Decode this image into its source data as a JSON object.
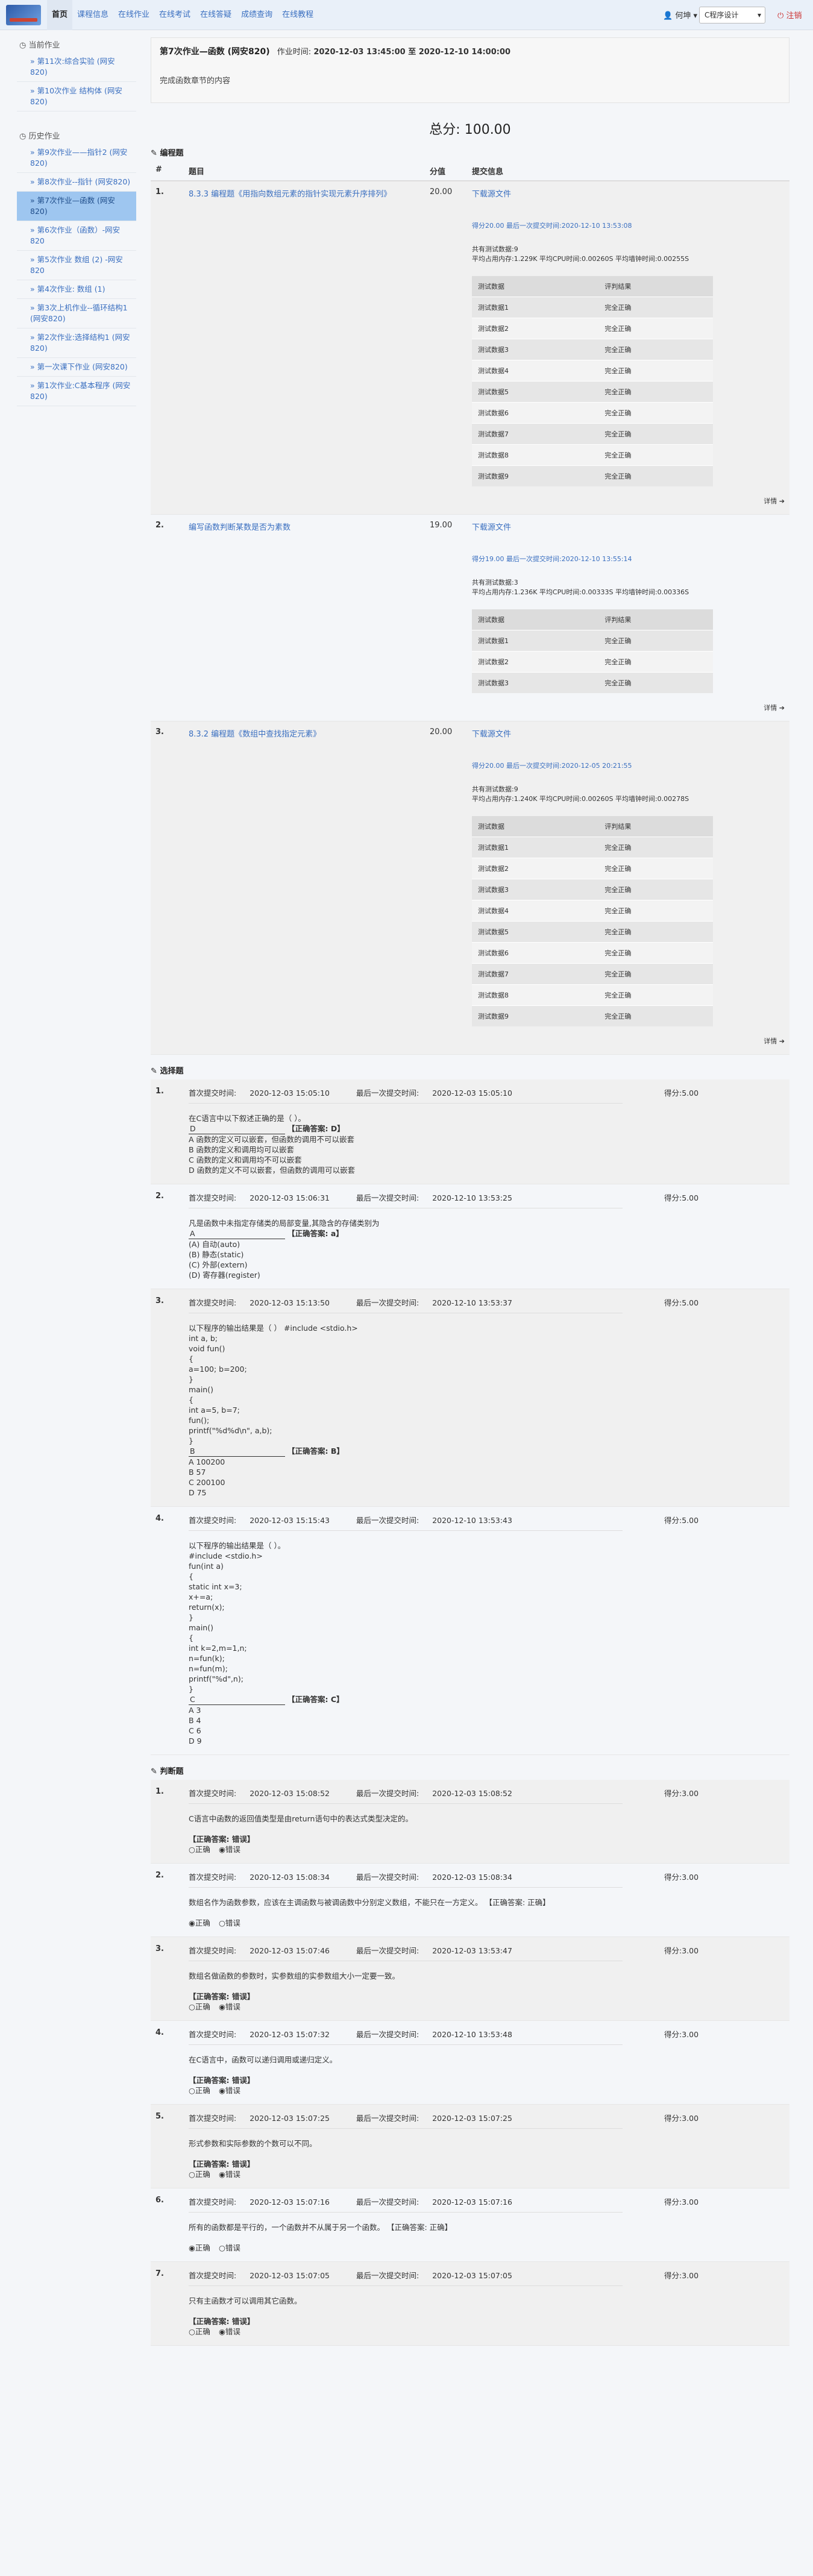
{
  "nav": {
    "items": [
      "首页",
      "课程信息",
      "在线作业",
      "在线考试",
      "在线答疑",
      "成绩查询",
      "在线教程"
    ],
    "active_index": 0,
    "user": "何坤",
    "course": "C程序设计",
    "logout": "注销"
  },
  "sidebar": {
    "current_label": "当前作业",
    "current_items": [
      "第11次:综合实验 (网安820)",
      "第10次作业 结构体 (网安820)"
    ],
    "history_label": "历史作业",
    "history_items": [
      "第9次作业——指针2 (网安820)",
      "第8次作业--指针 (网安820)",
      "第7次作业—函数 (网安820)",
      "第6次作业（函数）-网安820",
      "第5次作业 数组 (2) -网安820",
      "第4次作业: 数组 (1)",
      "第3次上机作业--循环结构1 (网安820)",
      "第2次作业:选择结构1 (网安820)",
      "第一次课下作业 (网安820)",
      "第1次作业:C基本程序 (网安820)"
    ],
    "active_history_index": 2
  },
  "homework": {
    "title": "第7次作业—函数 (网安820)",
    "time_label": "作业时间:",
    "time_value": "2020-12-03 13:45:00 至 2020-12-10 14:00:00",
    "desc": "完成函数章节的内容",
    "total": "总分: 100.00"
  },
  "programming": {
    "section": "编程题",
    "headers": [
      "#",
      "题目",
      "分值",
      "提交信息"
    ],
    "download": "下载源文件",
    "detail": "详情",
    "tc_headers": [
      "测试数据",
      "评判结果"
    ],
    "problems": [
      {
        "no": "1.",
        "name": "8.3.3 编程题《用指向数组元素的指针实现元素升序排列》",
        "score": "20.00",
        "meta": "得分20.00   最后一次提交时间:2020-12-10 13:53:08",
        "meta2": "共有测试数据:9\n平均占用内存:1.229K    平均CPU时间:0.00260S    平均墙钟时间:0.00255S",
        "tests": [
          "测试数据1",
          "测试数据2",
          "测试数据3",
          "测试数据4",
          "测试数据5",
          "测试数据6",
          "测试数据7",
          "测试数据8",
          "测试数据9"
        ],
        "result": "完全正确"
      },
      {
        "no": "2.",
        "name": "编写函数判断某数是否为素数",
        "score": "19.00",
        "meta": "得分19.00   最后一次提交时间:2020-12-10 13:55:14",
        "meta2": "共有测试数据:3\n平均占用内存:1.236K    平均CPU时间:0.00333S    平均墙钟时间:0.00336S",
        "tests": [
          "测试数据1",
          "测试数据2",
          "测试数据3"
        ],
        "result": "完全正确"
      },
      {
        "no": "3.",
        "name": "8.3.2 编程题《数组中查找指定元素》",
        "score": "20.00",
        "meta": "得分20.00   最后一次提交时间:2020-12-05 20:21:55",
        "meta2": "共有测试数据:9\n平均占用内存:1.240K    平均CPU时间:0.00260S    平均墙钟时间:0.00278S",
        "tests": [
          "测试数据1",
          "测试数据2",
          "测试数据3",
          "测试数据4",
          "测试数据5",
          "测试数据6",
          "测试数据7",
          "测试数据8",
          "测试数据9"
        ],
        "result": "完全正确"
      }
    ]
  },
  "choice": {
    "section": "选择题",
    "first_label": "首次提交时间:",
    "last_label": "最后一次提交时间:",
    "score_label": "得分:",
    "questions": [
      {
        "no": "1.",
        "first": "2020-12-03 15:05:10",
        "last": "2020-12-03 15:05:10",
        "score": "5.00",
        "body": "在C语言中以下叙述正确的是（ ）。",
        "blank": "D",
        "answer": "【正确答案: D】",
        "options": "A 函数的定义可以嵌套，但函数的调用不可以嵌套\nB 函数的定义和调用均可以嵌套\nC 函数的定义和调用均不可以嵌套\nD 函数的定义不可以嵌套，但函数的调用可以嵌套"
      },
      {
        "no": "2.",
        "first": "2020-12-03 15:06:31",
        "last": "2020-12-10 13:53:25",
        "score": "5.00",
        "body": "凡是函数中未指定存储类的局部变量,其隐含的存储类别为",
        "blank": "A",
        "answer": "【正确答案: a】",
        "options": "(A) 自动(auto)\n(B) 静态(static)\n(C) 外部(extern)\n(D) 寄存器(register)"
      },
      {
        "no": "3.",
        "first": "2020-12-03 15:13:50",
        "last": "2020-12-10 13:53:37",
        "score": "5.00",
        "body": "以下程序的输出结果是（ ）        #include <stdio.h>\nint a, b;\nvoid fun()\n{\na=100; b=200;\n}\nmain()\n{\nint a=5, b=7;\nfun();\nprintf(\"%d%d\\n\", a,b);\n}",
        "blank": "B",
        "answer": "【正确答案: B】",
        "options": "A 100200\nB 57\nC 200100\nD 75"
      },
      {
        "no": "4.",
        "first": "2020-12-03 15:15:43",
        "last": "2020-12-10 13:53:43",
        "score": "5.00",
        "body": "以下程序的输出结果是（ ）。\n#include <stdio.h>\nfun(int a)\n{\nstatic int x=3;\nx+=a;\nreturn(x);\n}\nmain()\n{\nint k=2,m=1,n;\nn=fun(k);\nn=fun(m);\nprintf(\"%d\",n);\n}",
        "blank": "C",
        "answer": "【正确答案: C】",
        "options": "A 3\nB 4\nC 6\nD 9"
      }
    ]
  },
  "judge": {
    "section": "判断题",
    "true_label": "正确",
    "false_label": "错误",
    "questions": [
      {
        "no": "1.",
        "first": "2020-12-03 15:08:52",
        "last": "2020-12-03 15:08:52",
        "score": "3.00",
        "body": "C语言中函数的返回值类型是由return语句中的表达式类型决定的。",
        "answer": "【正确答案: 错误】",
        "choice": "false"
      },
      {
        "no": "2.",
        "first": "2020-12-03 15:08:34",
        "last": "2020-12-03 15:08:34",
        "score": "3.00",
        "body": "数组名作为函数参数，应该在主调函数与被调函数中分别定义数组，不能只在一方定义。 【正确答案: 正确】",
        "answer": "",
        "choice": "true"
      },
      {
        "no": "3.",
        "first": "2020-12-03 15:07:46",
        "last": "2020-12-03 13:53:47",
        "score": "3.00",
        "body": "数组名做函数的参数时，实参数组的实参数组大小一定要一致。",
        "answer": "【正确答案: 错误】",
        "choice": "false"
      },
      {
        "no": "4.",
        "first": "2020-12-03 15:07:32",
        "last": "2020-12-10 13:53:48",
        "score": "3.00",
        "body": "在C语言中，函数可以递归调用或递归定义。",
        "answer": "【正确答案: 错误】",
        "choice": "false"
      },
      {
        "no": "5.",
        "first": "2020-12-03 15:07:25",
        "last": "2020-12-03 15:07:25",
        "score": "3.00",
        "body": "形式参数和实际参数的个数可以不同。",
        "answer": "【正确答案: 错误】",
        "choice": "false"
      },
      {
        "no": "6.",
        "first": "2020-12-03 15:07:16",
        "last": "2020-12-03 15:07:16",
        "score": "3.00",
        "body": "所有的函数都是平行的，一个函数并不从属于另一个函数。 【正确答案: 正确】",
        "answer": "",
        "choice": "true"
      },
      {
        "no": "7.",
        "first": "2020-12-03 15:07:05",
        "last": "2020-12-03 15:07:05",
        "score": "3.00",
        "body": "只有主函数才可以调用其它函数。",
        "answer": "【正确答案: 错误】",
        "choice": "false"
      }
    ]
  }
}
